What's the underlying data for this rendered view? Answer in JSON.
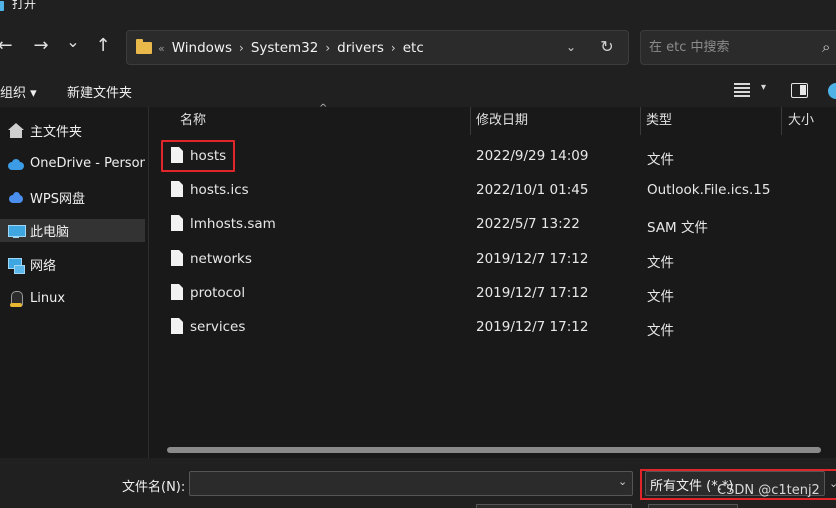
{
  "window": {
    "title": "打开"
  },
  "nav": {
    "back_glyph": "←",
    "forward_glyph": "→",
    "recent_glyph": "⌄",
    "up_glyph": "↑",
    "address": {
      "lead": "«",
      "crumbs": [
        "Windows",
        "System32",
        "drivers",
        "etc"
      ],
      "separator": "›",
      "chevron_glyph": "⌄",
      "refresh_glyph": "↻"
    },
    "search": {
      "placeholder": "在 etc 中搜索",
      "value": "",
      "glyph": "⌕"
    }
  },
  "toolbar": {
    "organize_label": "组织 ▾",
    "new_folder_label": "新建文件夹",
    "view_caret": "▾"
  },
  "sidebar": {
    "items": [
      {
        "label": "主文件夹",
        "icon": "home-icon",
        "selected": false
      },
      {
        "label": "OneDrive - Persona",
        "icon": "onedrive-icon",
        "selected": false
      },
      {
        "label": "WPS网盘",
        "icon": "wps-cloud-icon",
        "selected": false
      },
      {
        "label": "此电脑",
        "icon": "computer-icon",
        "selected": true
      },
      {
        "label": "网络",
        "icon": "network-icon",
        "selected": false
      },
      {
        "label": "Linux",
        "icon": "linux-icon",
        "selected": false
      }
    ]
  },
  "filelist": {
    "columns": {
      "name": "名称",
      "date": "修改日期",
      "type": "类型",
      "size": "大小"
    },
    "sort_caret": "^",
    "rows": [
      {
        "name": "hosts",
        "date": "2022/9/29 14:09",
        "type": "文件"
      },
      {
        "name": "hosts.ics",
        "date": "2022/10/1 01:45",
        "type": "Outlook.File.ics.15"
      },
      {
        "name": "lmhosts.sam",
        "date": "2022/5/7 13:22",
        "type": "SAM 文件"
      },
      {
        "name": "networks",
        "date": "2019/12/7 17:12",
        "type": "文件"
      },
      {
        "name": "protocol",
        "date": "2019/12/7 17:12",
        "type": "文件"
      },
      {
        "name": "services",
        "date": "2019/12/7 17:12",
        "type": "文件"
      }
    ]
  },
  "bottom": {
    "filename_label": "文件名(N):",
    "filename_value": "",
    "filename_chevron": "⌄",
    "filetype_value": "所有文件 (*.*)",
    "filetype_chevron": "⌄"
  },
  "watermark": "CSDN @c1tenj2",
  "colors": {
    "highlight": "#e0262a",
    "selected": "#333333",
    "accent": "#4fb3e8"
  }
}
